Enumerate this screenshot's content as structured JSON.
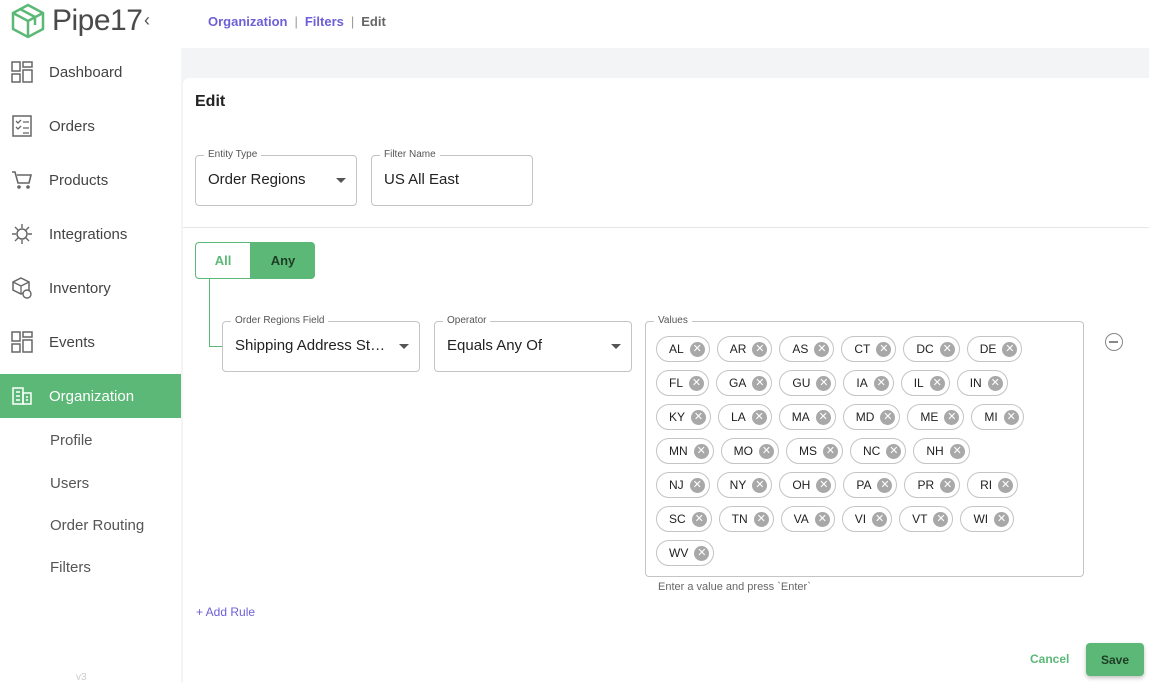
{
  "app": {
    "logo_text": "Pipe17",
    "version": "v3"
  },
  "sidebar": {
    "items": [
      {
        "label": "Dashboard",
        "icon": "dashboard-icon"
      },
      {
        "label": "Orders",
        "icon": "orders-icon"
      },
      {
        "label": "Products",
        "icon": "cart-icon"
      },
      {
        "label": "Integrations",
        "icon": "integrations-icon"
      },
      {
        "label": "Inventory",
        "icon": "inventory-icon"
      },
      {
        "label": "Events",
        "icon": "events-icon"
      },
      {
        "label": "Organization",
        "icon": "building-icon",
        "active": true
      }
    ],
    "sub_items": [
      "Profile",
      "Users",
      "Order Routing",
      "Filters"
    ]
  },
  "breadcrumb": {
    "items": [
      "Organization",
      "Filters"
    ],
    "current": "Edit"
  },
  "page": {
    "title": "Edit"
  },
  "form": {
    "entity_type": {
      "label": "Entity Type",
      "value": "Order Regions"
    },
    "filter_name": {
      "label": "Filter Name",
      "value": "US All East"
    },
    "match_toggle": {
      "all": "All",
      "any": "Any",
      "selected": "Any"
    },
    "rule": {
      "field": {
        "label": "Order Regions Field",
        "value": "Shipping Address State"
      },
      "operator": {
        "label": "Operator",
        "value": "Equals Any Of"
      },
      "values": {
        "label": "Values",
        "rows": [
          [
            "AL",
            "AR",
            "AS",
            "CT",
            "DC",
            "DE"
          ],
          [
            "FL",
            "GA",
            "GU",
            "IA",
            "IL",
            "IN"
          ],
          [
            "KY",
            "LA",
            "MA",
            "MD",
            "ME",
            "MI"
          ],
          [
            "MN",
            "MO",
            "MS",
            "NC",
            "NH"
          ],
          [
            "NJ",
            "NY",
            "OH",
            "PA",
            "PR",
            "RI"
          ],
          [
            "SC",
            "TN",
            "VA",
            "VI",
            "VT",
            "WI"
          ],
          [
            "WV"
          ]
        ],
        "helper": "Enter a value and press `Enter`"
      }
    },
    "add_rule": "+ Add Rule",
    "cancel": "Cancel",
    "save": "Save"
  },
  "colors": {
    "accent": "#5bb876",
    "link": "#6d5fd6"
  }
}
